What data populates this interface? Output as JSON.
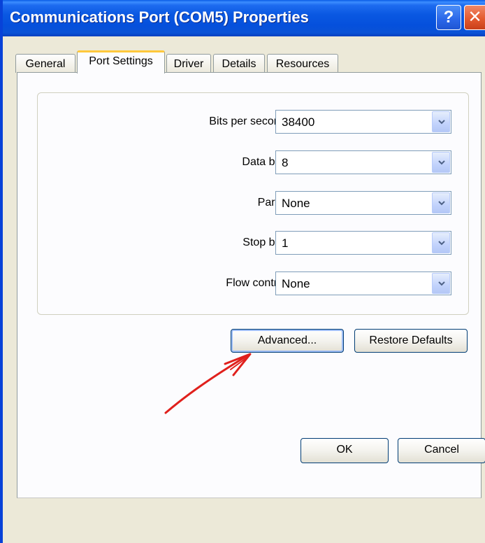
{
  "window": {
    "title": "Communications Port (COM5) Properties",
    "help_glyph": "?",
    "close_glyph": "✕"
  },
  "tabs": [
    {
      "label": "General"
    },
    {
      "label": "Port Settings"
    },
    {
      "label": "Driver"
    },
    {
      "label": "Details"
    },
    {
      "label": "Resources"
    }
  ],
  "active_tab": "Port Settings",
  "fields": [
    {
      "label": "Bits per second:",
      "value": "38400"
    },
    {
      "label": "Data bits:",
      "value": "8"
    },
    {
      "label": "Parity:",
      "value": "None"
    },
    {
      "label": "Stop bits:",
      "value": "1"
    },
    {
      "label": "Flow control:",
      "value": "None"
    }
  ],
  "buttons": {
    "advanced": "Advanced...",
    "restore_defaults": "Restore Defaults",
    "ok": "OK",
    "cancel": "Cancel"
  },
  "colors": {
    "titlebar": "#0a58e2",
    "annotation_arrow": "#e0201c",
    "active_tab_accent": "#ffc83c"
  }
}
